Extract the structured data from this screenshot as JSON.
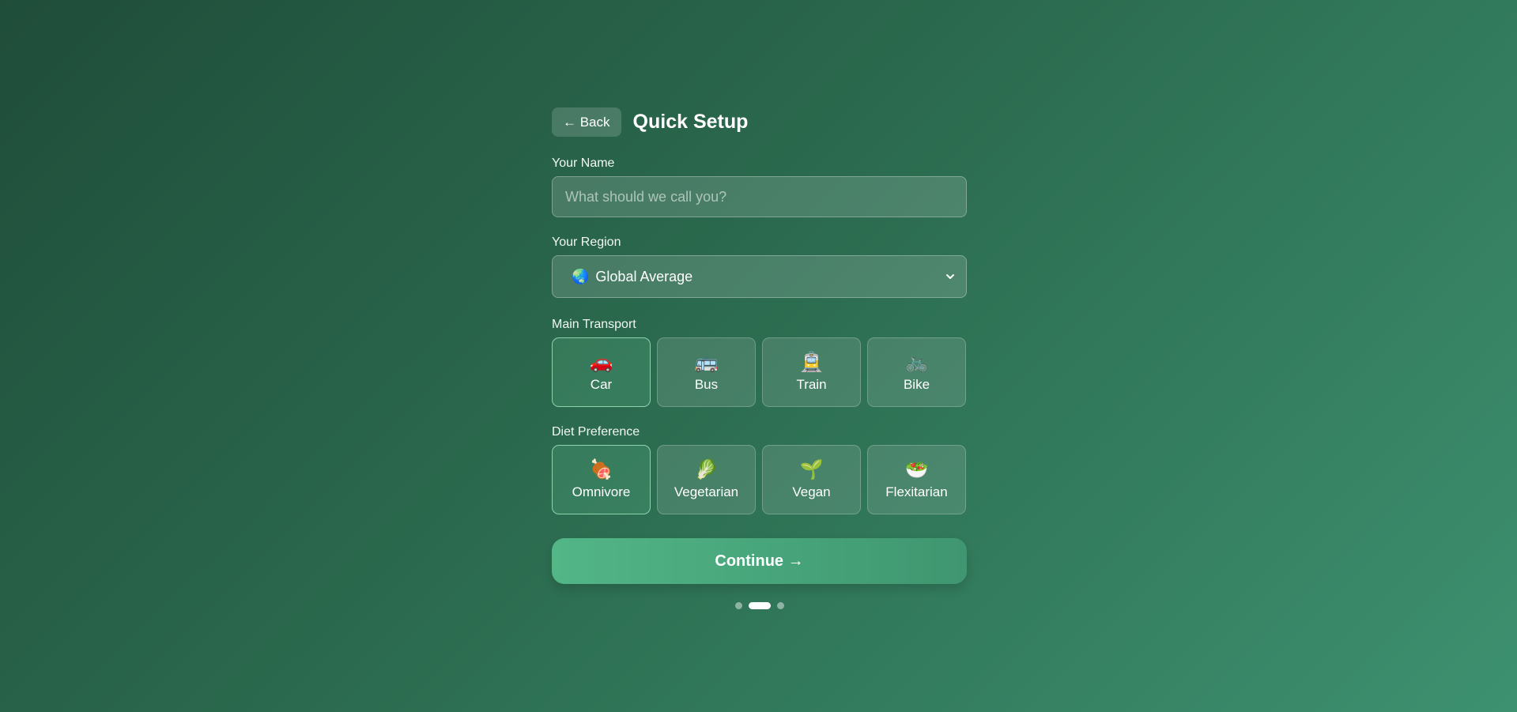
{
  "header": {
    "back_label": "← Back",
    "title": "Quick Setup"
  },
  "name_field": {
    "label": "Your Name",
    "placeholder": "What should we call you?",
    "value": ""
  },
  "region": {
    "label": "Your Region",
    "icon": "globe-icon",
    "selected": "Global Average"
  },
  "transport": {
    "label": "Main Transport",
    "selected": "Car",
    "options": [
      {
        "emoji": "🚗",
        "label": "Car",
        "icon": "car-icon"
      },
      {
        "emoji": "🚌",
        "label": "Bus",
        "icon": "bus-icon"
      },
      {
        "emoji": "🚊",
        "label": "Train",
        "icon": "train-icon"
      },
      {
        "emoji": "🚲",
        "label": "Bike",
        "icon": "bike-icon"
      }
    ]
  },
  "diet": {
    "label": "Diet Preference",
    "selected": "Omnivore",
    "options": [
      {
        "emoji": "🍖",
        "label": "Omnivore",
        "icon": "meat-icon"
      },
      {
        "emoji": "🥬",
        "label": "Vegetarian",
        "icon": "leafy-greens-icon"
      },
      {
        "emoji": "🌱",
        "label": "Vegan",
        "icon": "seedling-icon"
      },
      {
        "emoji": "🥗",
        "label": "Flexitarian",
        "icon": "salad-icon"
      }
    ]
  },
  "continue_label": "Continue →",
  "pagination": {
    "total": 3,
    "current": 2
  },
  "colors": {
    "accent": "#52b687",
    "background_start": "#1f4d3a",
    "background_end": "#3d9170"
  }
}
